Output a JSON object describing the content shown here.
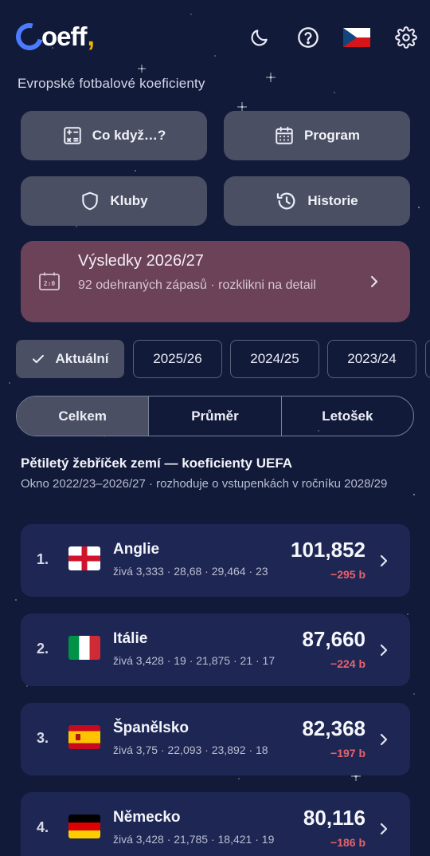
{
  "app": {
    "logo_text": "oeff",
    "logo_comma": ",",
    "subtitle": "Evropské fotbalové koeficienty"
  },
  "topbar": {
    "icons": [
      "moon-icon",
      "help-icon",
      "czech-flag-icon",
      "gear-icon"
    ]
  },
  "actions": {
    "whatif": "Co když…?",
    "program": "Program",
    "clubs": "Kluby",
    "history": "Historie"
  },
  "results": {
    "title": "Výsledky 2026/27",
    "subtitle": "92 odehraných zápasů · rozklikni na detail"
  },
  "seasons": [
    {
      "label": "Aktuální",
      "active": true
    },
    {
      "label": "2025/26",
      "active": false
    },
    {
      "label": "2024/25",
      "active": false
    },
    {
      "label": "2023/24",
      "active": false
    }
  ],
  "segments": [
    {
      "label": "Celkem",
      "active": true
    },
    {
      "label": "Průměr",
      "active": false
    },
    {
      "label": "Letošek",
      "active": false
    }
  ],
  "ranking": {
    "title": "Pětiletý žebříček zemí — koeficienty UEFA",
    "subtitle": "Okno 2022/23–2026/27 · rozhoduje o vstupenkách v ročníku 2028/29",
    "rows": [
      {
        "rank": "1.",
        "country": "Anglie",
        "detail": "živá 3,333 · 28,68 · 29,464 · 23",
        "value": "101,852",
        "delta": "−295 b",
        "flag": "england"
      },
      {
        "rank": "2.",
        "country": "Itálie",
        "detail": "živá 3,428 · 19 · 21,875 · 21 · 17",
        "value": "87,660",
        "delta": "−224 b",
        "flag": "italy"
      },
      {
        "rank": "3.",
        "country": "Španělsko",
        "detail": "živá 3,75 · 22,093 · 23,892 · 18",
        "value": "82,368",
        "delta": "−197 b",
        "flag": "spain"
      },
      {
        "rank": "4.",
        "country": "Německo",
        "detail": "živá 3,428 · 21,785 · 18,421 · 19",
        "value": "80,116",
        "delta": "−186 b",
        "flag": "germany"
      }
    ]
  },
  "colors": {
    "background": "#121a3a",
    "card": "#1e2754",
    "tile": "#4a4f63",
    "results_card": "#6b4258",
    "delta_negative": "#e9626b",
    "logo_blue": "#4b7bff",
    "logo_accent": "#f5b400"
  }
}
